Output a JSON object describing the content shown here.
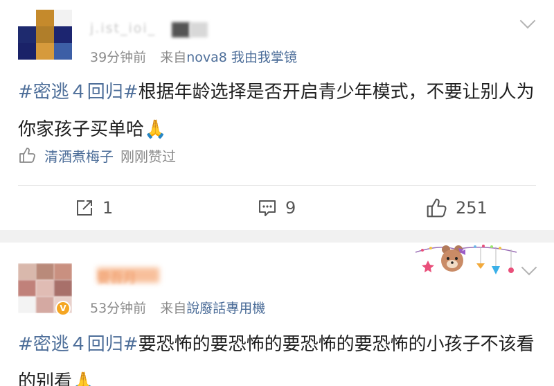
{
  "post1": {
    "username": "j.ist_ioi_",
    "time": "39分钟前",
    "from_label": "来自",
    "source": "nova8 我由我掌镜",
    "topic": "#密逃４回归#",
    "text": "根据年龄选择是否开启青少年模式，不要让别人为你家孩子买单哈",
    "emoji": "🙏",
    "liker": "清酒煮梅子",
    "liked_text": "刚刚赞过",
    "repost_count": "1",
    "comment_count": "9",
    "like_count": "251"
  },
  "post2": {
    "username": "要吾月",
    "time": "53分钟前",
    "from_label": "来自",
    "source": "說廢話專用機",
    "topic": "#密逃４回归#",
    "text": "要恐怖的要恐怖的要恐怖的要恐怖的小孩子不该看的别看",
    "emoji": "🙏"
  },
  "icons": {
    "chevron": "chevron-down-icon",
    "thumb": "thumb-up-icon",
    "repost": "repost-icon",
    "comment": "comment-icon",
    "verified": "verified-badge-icon"
  },
  "colors": {
    "link_blue": "#4d6e99",
    "meta_gray": "#8a8a8a",
    "divider": "#f1f1f1"
  }
}
